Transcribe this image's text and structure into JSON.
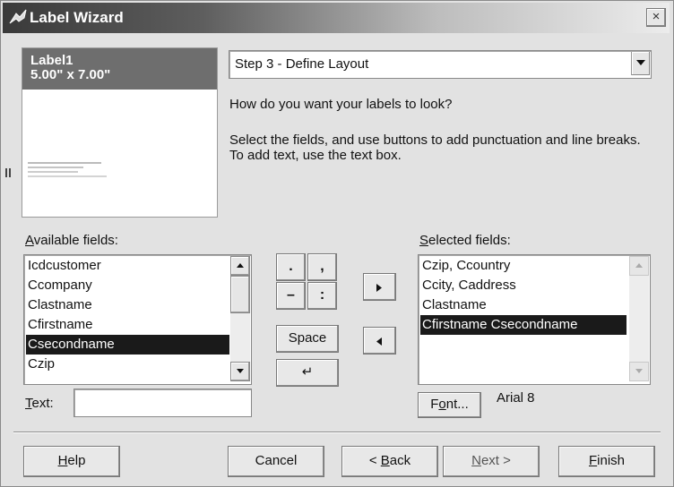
{
  "window": {
    "title": "Label Wizard",
    "close_label": "×"
  },
  "preview": {
    "name": "Label1",
    "size": "5.00\" x 7.00\""
  },
  "step": {
    "selected": "Step 3 - Define Layout"
  },
  "instructions": {
    "question": "How do you want your labels to look?",
    "detail": "Select the fields, and use buttons to add punctuation and line breaks. To add text, use the text box."
  },
  "available_fields": {
    "label_access_key": "A",
    "label_rest": "vailable fields:",
    "items": [
      "Icdcustomer",
      "Ccompany",
      "Clastname",
      "Cfirstname",
      "Csecondname",
      "Czip"
    ],
    "selected_index": 4
  },
  "selected_fields": {
    "label_pre": "",
    "label_access_key": "S",
    "label_rest": "elected fields:",
    "items": [
      "Czip, Ccountry",
      "Ccity, Caddress",
      "Clastname",
      "Cfirstname Csecondname"
    ],
    "selected_index": 3
  },
  "punctuation": {
    "period": ".",
    "comma": ",",
    "dash": "–",
    "colon": ":"
  },
  "buttons": {
    "space": "Space",
    "newline": "↵",
    "font_pre": "F",
    "font_key": "o",
    "font_post": "nt...",
    "help_key": "H",
    "help_post": "elp",
    "cancel": "Cancel",
    "back_pre": "< ",
    "back_key": "B",
    "back_post": "ack",
    "next_key": "N",
    "next_post": "ext >",
    "finish_key": "F",
    "finish_post": "inish"
  },
  "text_field": {
    "label_key": "T",
    "label_rest": "ext:",
    "value": ""
  },
  "font": {
    "value": "Arial 8"
  }
}
